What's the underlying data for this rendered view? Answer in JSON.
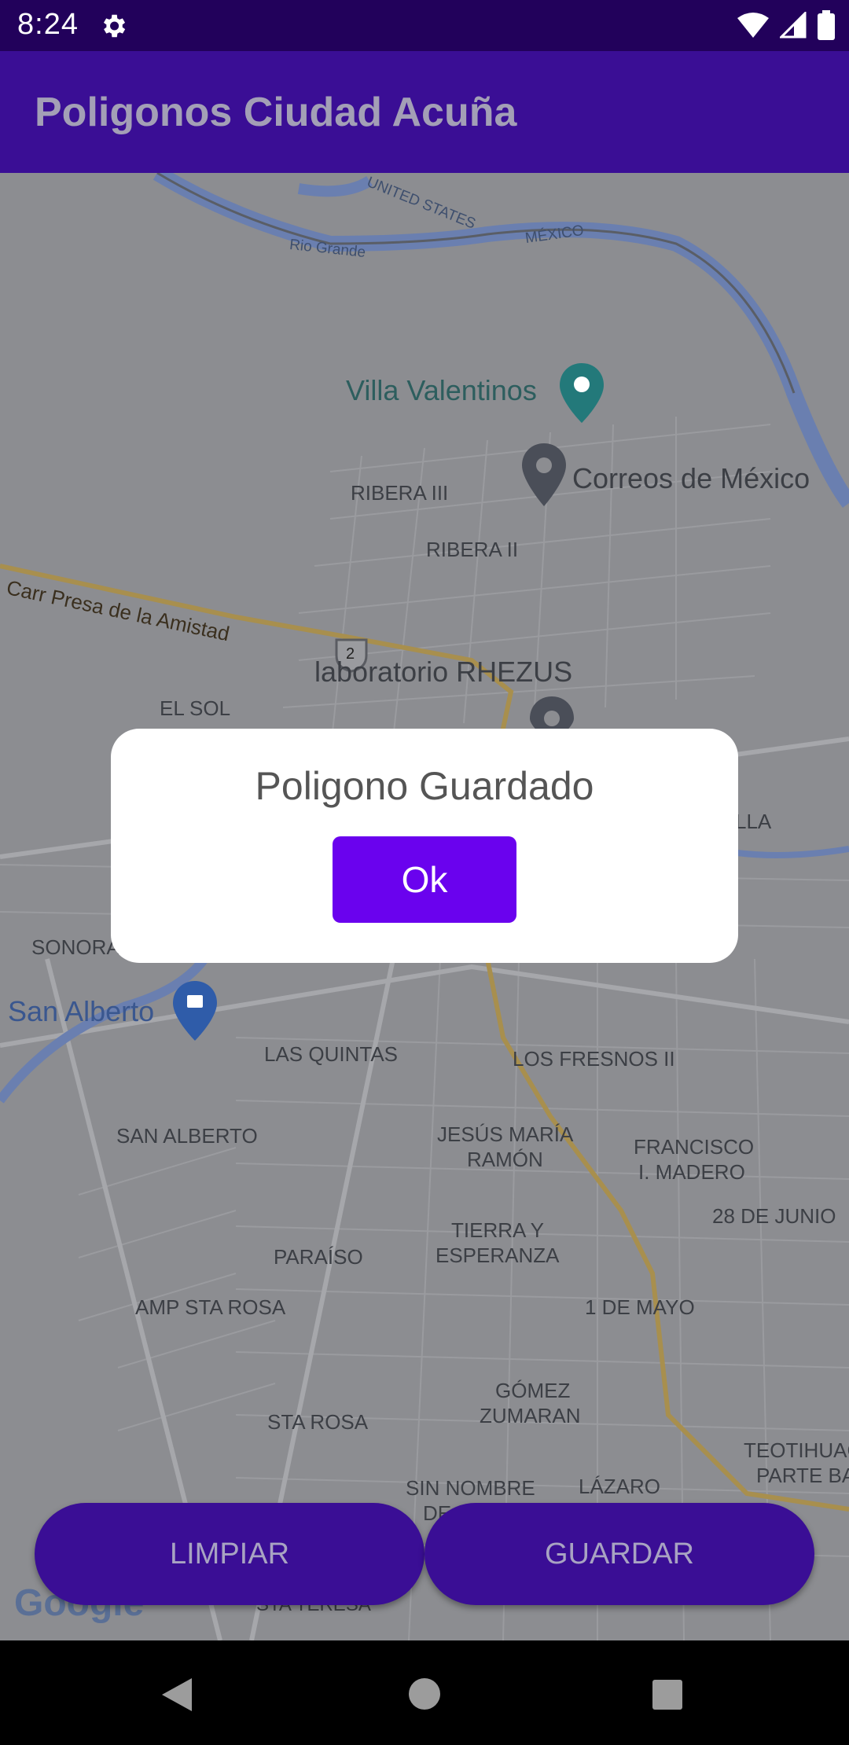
{
  "status_bar": {
    "time": "8:24",
    "icons": [
      "gear-icon",
      "wifi-icon",
      "signal-icon",
      "battery-icon"
    ]
  },
  "app_bar": {
    "title": "Poligonos Ciudad Acuña"
  },
  "map": {
    "labels": {
      "united_states": "UNITED STATES",
      "mexico": "MÉXICO",
      "rio_grande": "Rio Grande",
      "villa_valentinos": "Villa Valentinos",
      "correos": "Correos de México",
      "ribera_iii": "RIBERA III",
      "ribera_ii": "RIBERA II",
      "carr_presa": "Carr Presa de la Amistad",
      "route_2": "2",
      "laboratorio": "laboratorio RHEZUS",
      "el_sol": "EL SOL",
      "lla": "LLA",
      "sonora": "SONORA",
      "san_alberto_poi": "San Alberto",
      "las_quintas": "LAS QUINTAS",
      "los_fresnos": "LOS FRESNOS II",
      "san_alberto": "SAN ALBERTO",
      "jesus_maria_1": "JESÚS MARÍA",
      "jesus_maria_2": "RAMÓN",
      "francisco_1": "FRANCISCO",
      "francisco_2": "I. MADERO",
      "junio": "28 DE JUNIO",
      "tierra_1": "TIERRA Y",
      "tierra_2": "ESPERANZA",
      "paraiso": "PARAÍSO",
      "amp_sta_rosa": "AMP STA ROSA",
      "mayo": "1 DE MAYO",
      "gomez_1": "GÓMEZ",
      "gomez_2": "ZUMARAN",
      "sta_rosa": "STA ROSA",
      "teotihua_1": "TEOTIHUAC",
      "teotihua_2": "PARTE BA",
      "sin_nombre_1": "SIN NOMBRE",
      "sin_nombre_2": "DE",
      "lazaro": "LÁZARO",
      "sta_teresa": "STA TERESA"
    },
    "google_logo": "Google"
  },
  "dialog": {
    "title": "Poligono Guardado",
    "ok_label": "Ok"
  },
  "buttons": {
    "limpiar": "LIMPIAR",
    "guardar": "GUARDAR"
  },
  "nav_bar": {
    "icons": [
      "back-icon",
      "home-icon",
      "recents-icon"
    ]
  },
  "colors": {
    "status_bar": "#22015b",
    "app_bar": "#3a0e95",
    "dialog_button": "#6a02ee",
    "map_bg": "#8c8d91"
  }
}
